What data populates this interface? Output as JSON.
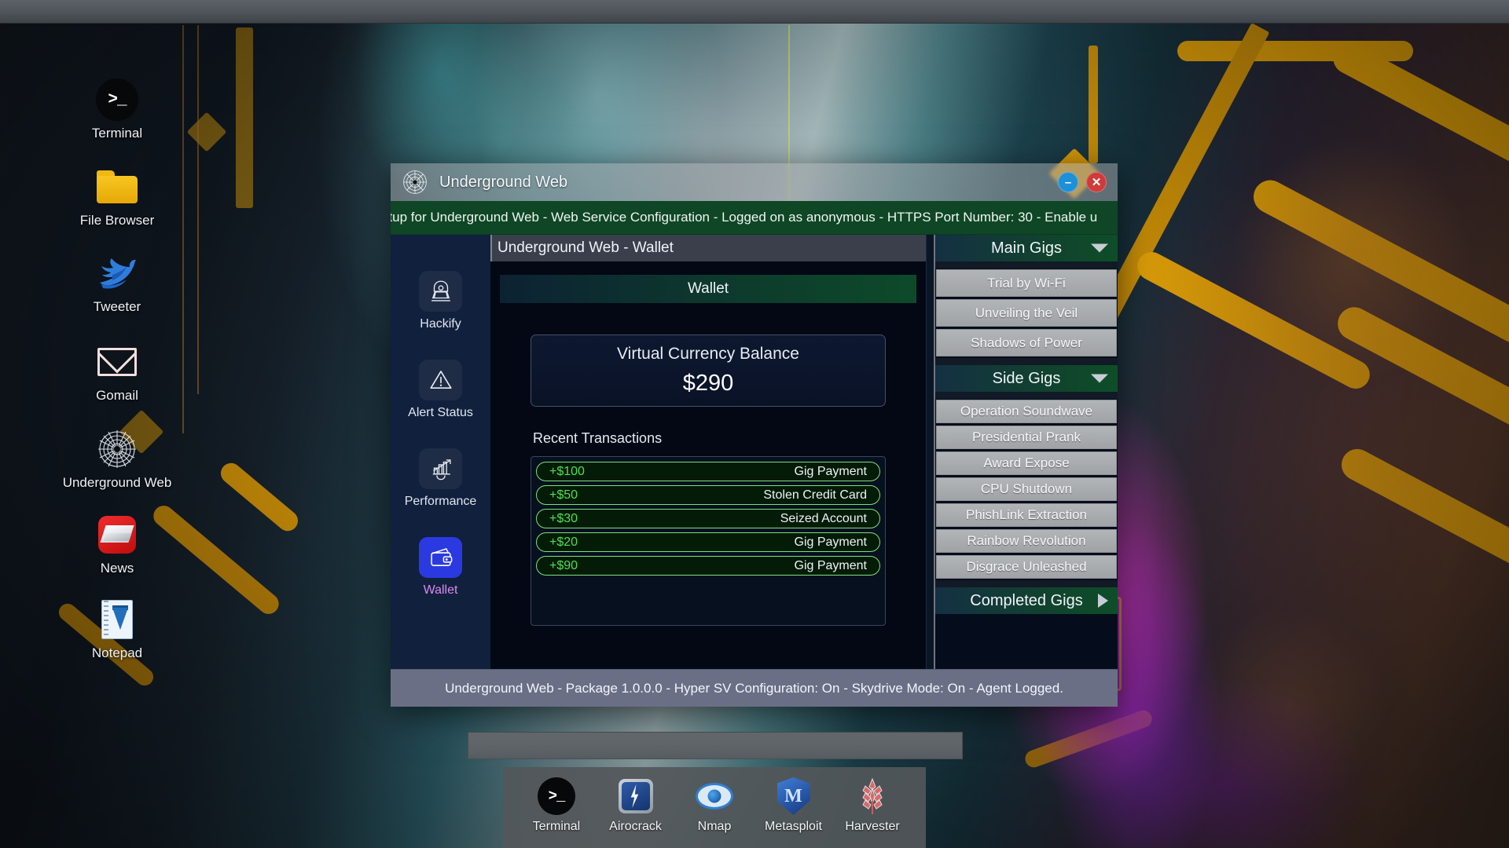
{
  "desktop": {
    "icons": [
      {
        "label": "Terminal",
        "icon": "terminal-icon"
      },
      {
        "label": "File Browser",
        "icon": "folder-icon"
      },
      {
        "label": "Tweeter",
        "icon": "bird-icon"
      },
      {
        "label": "Gomail",
        "icon": "envelope-icon"
      },
      {
        "label": "Underground Web",
        "icon": "spider-web-icon"
      },
      {
        "label": "News",
        "icon": "newspaper-icon"
      },
      {
        "label": "Notepad",
        "icon": "notepad-icon"
      }
    ]
  },
  "dock": {
    "items": [
      {
        "label": "Terminal",
        "icon": "terminal-icon"
      },
      {
        "label": "Airocrack",
        "icon": "lightning-shield-icon"
      },
      {
        "label": "Nmap",
        "icon": "eye-icon"
      },
      {
        "label": "Metasploit",
        "icon": "shield-m-icon"
      },
      {
        "label": "Harvester",
        "icon": "wheat-icon"
      }
    ]
  },
  "window": {
    "title": "Underground Web",
    "app_icon": "spider-web-icon",
    "minimize_label": "–",
    "close_label": "✕",
    "marquee": "etup for Underground Web - Web Service Configuration - Logged on as anonymous - HTTPS Port Number: 30 - Enable u",
    "content_header": "Underground Web - Wallet",
    "statusbar": "Underground Web - Package 1.0.0.0 - Hyper SV Configuration: On - Skydrive Mode: On - Agent Logged."
  },
  "sidenav": {
    "items": [
      {
        "label": "Hackify",
        "icon": "hacker-hoodie-icon",
        "active": false
      },
      {
        "label": "Alert Status",
        "icon": "warning-triangle-icon",
        "active": false
      },
      {
        "label": "Performance",
        "icon": "bar-chart-arrow-icon",
        "active": false
      },
      {
        "label": "Wallet",
        "icon": "wallet-icon",
        "active": true
      }
    ]
  },
  "wallet": {
    "banner": "Wallet",
    "balance_caption": "Virtual Currency Balance",
    "balance_amount": "$290",
    "transactions_title": "Recent Transactions",
    "transactions": [
      {
        "amount": "+$100",
        "source": "Gig Payment"
      },
      {
        "amount": "+$50",
        "source": "Stolen Credit Card"
      },
      {
        "amount": "+$30",
        "source": "Seized Account"
      },
      {
        "amount": "+$20",
        "source": "Gig Payment"
      },
      {
        "amount": "+$90",
        "source": "Gig Payment"
      }
    ]
  },
  "gigs": {
    "main": {
      "title": "Main Gigs",
      "state": "expanded",
      "items": [
        "Trial by Wi-Fi",
        "Unveiling the Veil",
        "Shadows of Power"
      ]
    },
    "side": {
      "title": "Side Gigs",
      "state": "expanded",
      "items": [
        "Operation Soundwave",
        "Presidential Prank",
        "Award Expose",
        "CPU Shutdown",
        "PhishLink Extraction",
        "Rainbow Revolution",
        "Disgrace Unleashed"
      ]
    },
    "completed": {
      "title": "Completed Gigs",
      "state": "collapsed",
      "items": []
    }
  },
  "colors": {
    "accent_green": "#0f4626",
    "accent_blue": "#2b3ae0",
    "active_label": "#d98bf0",
    "tx_green": "#4ee04e",
    "close_red": "#cf3b3b",
    "minimize_blue": "#1e90d8"
  }
}
